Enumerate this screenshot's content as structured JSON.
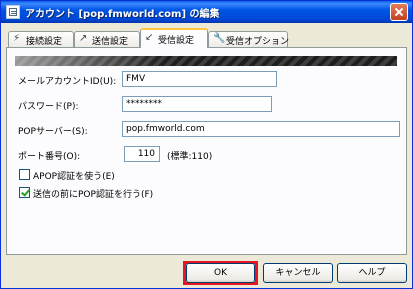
{
  "window": {
    "title": "アカウント [pop.fmworld.com] の編集"
  },
  "tabs": [
    {
      "label": "接続設定",
      "icon": "connection-icon",
      "glyph": "⚡",
      "active": false
    },
    {
      "label": "送信設定",
      "icon": "send-icon",
      "glyph": "↗",
      "active": false
    },
    {
      "label": "受信設定",
      "icon": "receive-icon",
      "glyph": "↙",
      "active": true
    },
    {
      "label": "受信オプション",
      "icon": "receive-options-icon",
      "glyph": "🔧",
      "active": false
    }
  ],
  "form": {
    "account_id_label": "メールアカウントID(U):",
    "account_id_value": "FMV",
    "password_label": "パスワード(P):",
    "password_value": "********",
    "pop_server_label": "POPサーバー(S):",
    "pop_server_value": "pop.fmworld.com",
    "port_label": "ポート番号(O):",
    "port_value": "110",
    "port_note": "(標準:110)",
    "apop_label": "APOP認証を使う(E)",
    "apop_checked": false,
    "pop_before_send_label": "送信の前にPOP認証を行う(F)",
    "pop_before_send_checked": true
  },
  "buttons": {
    "ok": "OK",
    "cancel": "キャンセル",
    "help": "ヘルプ"
  },
  "colors": {
    "title_bar": "#0055e5",
    "highlight": "#e8151c",
    "active_tab_accent": "#ffc83c"
  }
}
